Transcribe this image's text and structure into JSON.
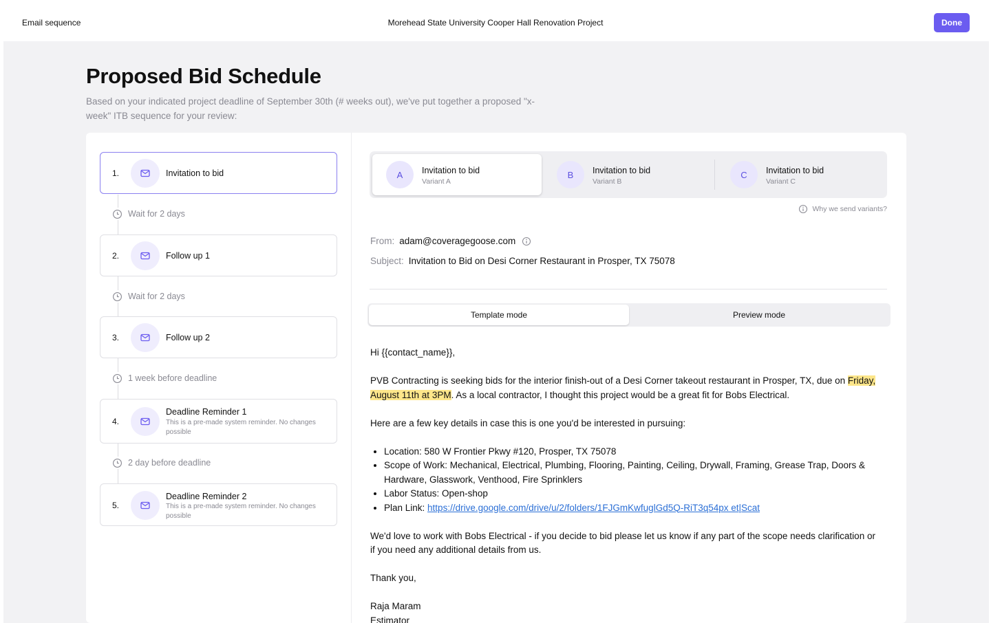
{
  "topbar": {
    "left_title": "Email sequence",
    "center_title": "Morehead State University Cooper Hall Renovation Project",
    "done_label": "Done"
  },
  "page": {
    "title": "Proposed Bid Schedule",
    "subtitle": "Based on your indicated project deadline of September 30th (# weeks out), we've put together a proposed \"x-week\" ITB sequence for your review:"
  },
  "steps": [
    {
      "num": "1.",
      "label": "Invitation to bid",
      "note": ""
    },
    {
      "num": "2.",
      "label": "Follow up 1",
      "note": ""
    },
    {
      "num": "3.",
      "label": "Follow up 2",
      "note": ""
    },
    {
      "num": "4.",
      "label": "Deadline Reminder 1",
      "note": "This is a pre-made system reminder. No changes possible"
    },
    {
      "num": "5.",
      "label": "Deadline Reminder 2",
      "note": "This is a pre-made system reminder. No changes possible"
    }
  ],
  "waits": [
    "Wait for 2 days",
    "Wait for 2 days",
    "1 week before deadline",
    "2 day before deadline"
  ],
  "variants": [
    {
      "letter": "A",
      "title": "Invitation to bid",
      "sub": "Variant A"
    },
    {
      "letter": "B",
      "title": "Invitation to bid",
      "sub": "Variant B"
    },
    {
      "letter": "C",
      "title": "Invitation to bid",
      "sub": "Variant C"
    }
  ],
  "why_label": "Why we send variants?",
  "email": {
    "from_label": "From:",
    "from_value": "adam@coveragegoose.com",
    "subject_label": "Subject:",
    "subject_value": "Invitation to Bid on Desi Corner Restaurant in Prosper, TX 75078",
    "greeting": "Hi {{contact_name}},",
    "p1_before": "PVB Contracting is seeking bids for the interior finish-out of a Desi Corner takeout restaurant in Prosper, TX, due on ",
    "p1_highlight": "Friday, August 11th at 3PM",
    "p1_after": ". As a local contractor, I thought this project would be a great fit for Bobs Electrical.",
    "p2": "Here are a few key details in case this is one you'd be interested in pursuing:",
    "bullets": {
      "location": "Location: 580 W Frontier Pkwy #120, Prosper, TX 75078",
      "scope": "Scope of Work: Mechanical, Electrical, Plumbing, Flooring, Painting, Ceiling, Drywall, Framing, Grease Trap, Doors & Hardware, Glasswork, Venthood, Fire Sprinklers",
      "labor": "Labor Status: Open-shop",
      "plan_prefix": "Plan Link: ",
      "plan_link": "https://drive.google.com/drive/u/2/folders/1FJGmKwfuglGd5Q-RiT3q54px et|Scat"
    },
    "p3": "We'd love to work with Bobs Electrical - if you decide to bid please let us know if any part of the scope needs clarification or if you need any additional details from us.",
    "signoff": "Thank you,",
    "sig_name": "Raja Maram",
    "sig_title": "Estimator"
  },
  "modes": {
    "template": "Template mode",
    "preview": "Preview mode"
  },
  "colors": {
    "accent": "#6b5cf0",
    "highlight": "#fde68a",
    "link": "#2b6fd6"
  }
}
